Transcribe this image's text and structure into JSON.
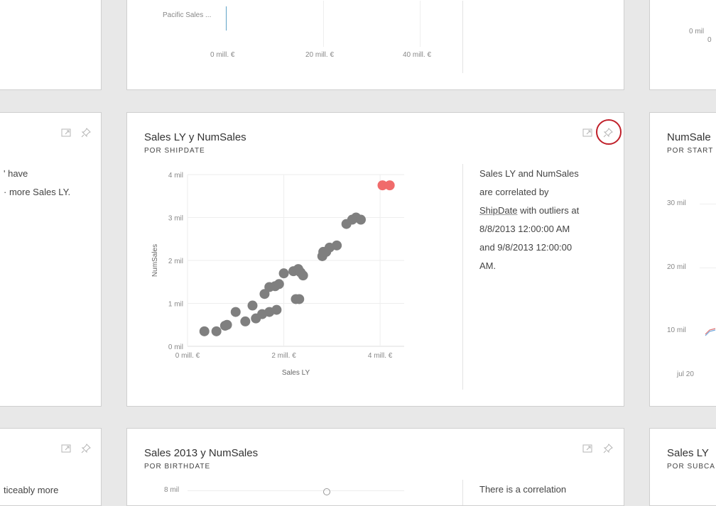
{
  "top_row": {
    "middle_card": {
      "legend_label": "Pacific Sales ...",
      "x_ticks": [
        "0 mill. €",
        "20 mill. €",
        "40 mill. €"
      ]
    },
    "right_card": {
      "tick_1": "0 mil",
      "tick_2": "0"
    }
  },
  "middle_row": {
    "left_card": {
      "lines": [
        "' have",
        "· more Sales LY."
      ]
    },
    "main_card": {
      "title": "Sales LY y NumSales",
      "subtitle": "POR SHIPDATE",
      "insight": {
        "line1": "Sales LY and NumSales",
        "line2": "are correlated by",
        "link": "ShipDate",
        "line3_rest": " with outliers at",
        "line4": "8/8/2013 12:00:00 AM",
        "line5": "and 9/8/2013 12:00:00",
        "line6": "AM."
      }
    },
    "right_card": {
      "title": "NumSale",
      "subtitle": "POR START",
      "y_ticks": [
        "30 mil",
        "20 mil",
        "10 mil"
      ],
      "x_tick": "jul 20"
    }
  },
  "bottom_row": {
    "left_card": {
      "text": "ticeably more"
    },
    "main_card": {
      "title": "Sales 2013 y NumSales",
      "subtitle": "POR BIRTHDATE",
      "y_tick": "8 mil",
      "insight_line1": "There is a correlation"
    },
    "right_card": {
      "title": "Sales LY",
      "subtitle": "POR SUBCA"
    }
  },
  "icons": {
    "focus": "focus-mode-icon",
    "pin": "pin-icon"
  },
  "colors": {
    "point": "#7f7f7f",
    "outlier": "#f06b6b",
    "highlight_circle": "#c0202a"
  },
  "chart_data": {
    "type": "scatter",
    "title": "",
    "xlabel": "Sales LY",
    "ylabel": "NumSales",
    "xlim": [
      0,
      4.5
    ],
    "ylim": [
      0,
      4
    ],
    "x_ticks": [
      "0 mill. €",
      "2 mill. €",
      "4 mill. €"
    ],
    "y_ticks": [
      "0 mil",
      "1 mil",
      "2 mil",
      "3 mil",
      "4 mil"
    ],
    "series": [
      {
        "color": "#7f7f7f",
        "points": [
          [
            0.35,
            0.35
          ],
          [
            0.6,
            0.35
          ],
          [
            0.78,
            0.48
          ],
          [
            0.82,
            0.5
          ],
          [
            1.0,
            0.8
          ],
          [
            1.2,
            0.58
          ],
          [
            1.35,
            0.95
          ],
          [
            1.42,
            0.65
          ],
          [
            1.55,
            0.75
          ],
          [
            1.7,
            0.8
          ],
          [
            1.85,
            0.85
          ],
          [
            1.6,
            1.22
          ],
          [
            1.7,
            1.38
          ],
          [
            1.82,
            1.4
          ],
          [
            1.9,
            1.45
          ],
          [
            2.0,
            1.7
          ],
          [
            2.2,
            1.75
          ],
          [
            2.3,
            1.8
          ],
          [
            2.35,
            1.72
          ],
          [
            2.4,
            1.65
          ],
          [
            2.25,
            1.1
          ],
          [
            2.32,
            1.1
          ],
          [
            2.8,
            2.1
          ],
          [
            2.88,
            2.2
          ],
          [
            2.95,
            2.3
          ],
          [
            3.1,
            2.35
          ],
          [
            2.82,
            2.2
          ],
          [
            3.3,
            2.85
          ],
          [
            3.42,
            2.95
          ],
          [
            3.5,
            3.0
          ],
          [
            3.6,
            2.95
          ]
        ]
      },
      {
        "color": "#f06b6b",
        "points": [
          [
            4.05,
            3.75
          ],
          [
            4.2,
            3.75
          ]
        ]
      }
    ]
  }
}
